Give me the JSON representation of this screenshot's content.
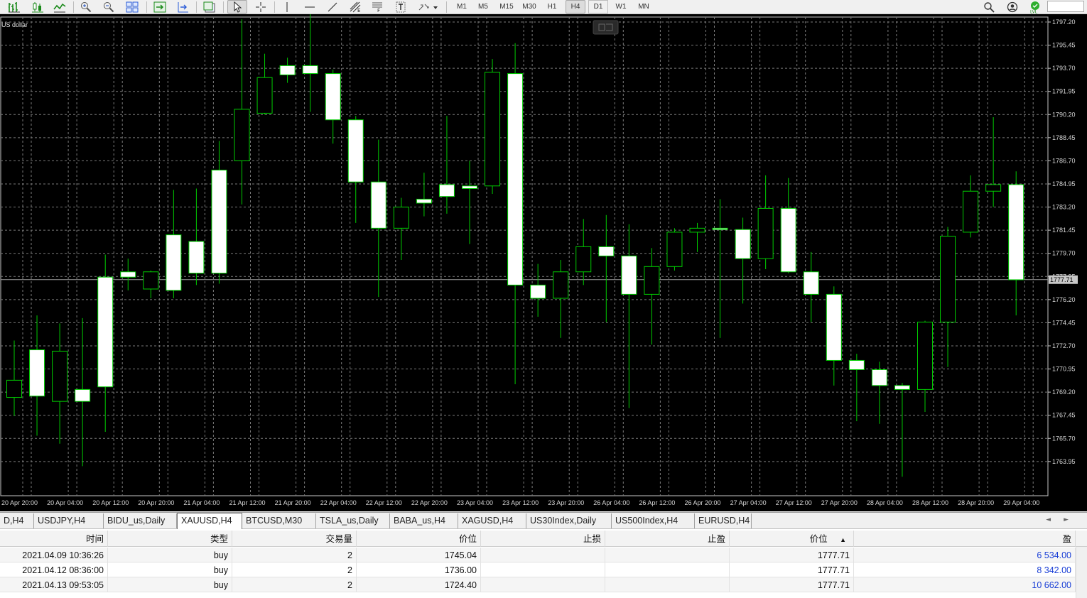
{
  "toolbar": {
    "timeframes": [
      "M1",
      "M5",
      "M15",
      "M30",
      "H1",
      "H4",
      "D1",
      "W1",
      "MN"
    ],
    "active_timeframe": "H4"
  },
  "chart": {
    "symbol_label": "US dollar",
    "price_labels": [
      "1797.20",
      "1795.45",
      "1793.70",
      "1791.95",
      "1790.20",
      "1788.45",
      "1786.70",
      "1784.95",
      "1783.20",
      "1781.45",
      "1779.70",
      "1777.95",
      "1776.20",
      "1774.45",
      "1772.70",
      "1770.95",
      "1769.20",
      "1767.45",
      "1765.70",
      "1763.95"
    ],
    "current_price": "1777.71",
    "time_labels": [
      "20 Apr 20:00",
      "20 Apr 04:00",
      "20 Apr 12:00",
      "20 Apr 20:00",
      "21 Apr 04:00",
      "21 Apr 12:00",
      "21 Apr 20:00",
      "22 Apr 04:00",
      "22 Apr 12:00",
      "22 Apr 20:00",
      "23 Apr 04:00",
      "23 Apr 12:00",
      "23 Apr 20:00",
      "26 Apr 04:00",
      "26 Apr 12:00",
      "26 Apr 20:00",
      "27 Apr 04:00",
      "27 Apr 12:00",
      "27 Apr 20:00",
      "28 Apr 04:00",
      "28 Apr 12:00",
      "28 Apr 20:00",
      "29 Apr 04:00"
    ],
    "colors": {
      "background": "#000000",
      "grid": "#7a7a7a",
      "candle_body": "#ffffff",
      "candle_wick": "#00cc00",
      "bid_line": "#9a9a9a"
    }
  },
  "chart_data": {
    "type": "candlestick",
    "title": "US dollar",
    "ylim": [
      1762.4,
      1798.3
    ],
    "candles": [
      {
        "o": 1768.8,
        "h": 1773.1,
        "l": 1767.4,
        "c": 1770.1
      },
      {
        "o": 1772.4,
        "h": 1775.0,
        "l": 1765.9,
        "c": 1768.9
      },
      {
        "o": 1768.5,
        "h": 1774.4,
        "l": 1765.3,
        "c": 1772.3
      },
      {
        "o": 1769.4,
        "h": 1774.8,
        "l": 1763.6,
        "c": 1768.5
      },
      {
        "o": 1777.9,
        "h": 1779.6,
        "l": 1766.2,
        "c": 1769.6
      },
      {
        "o": 1778.3,
        "h": 1779.3,
        "l": 1776.9,
        "c": 1777.9
      },
      {
        "o": 1777.0,
        "h": 1778.4,
        "l": 1776.3,
        "c": 1778.3
      },
      {
        "o": 1781.1,
        "h": 1784.5,
        "l": 1776.3,
        "c": 1776.9
      },
      {
        "o": 1780.6,
        "h": 1784.6,
        "l": 1777.3,
        "c": 1778.2
      },
      {
        "o": 1786.0,
        "h": 1788.2,
        "l": 1777.4,
        "c": 1778.2
      },
      {
        "o": 1786.7,
        "h": 1797.4,
        "l": 1783.4,
        "c": 1790.6
      },
      {
        "o": 1790.3,
        "h": 1794.8,
        "l": 1790.2,
        "c": 1793.0
      },
      {
        "o": 1793.9,
        "h": 1794.5,
        "l": 1792.6,
        "c": 1793.2
      },
      {
        "o": 1793.9,
        "h": 1797.8,
        "l": 1790.4,
        "c": 1793.3
      },
      {
        "o": 1793.3,
        "h": 1793.6,
        "l": 1788.0,
        "c": 1789.8
      },
      {
        "o": 1789.8,
        "h": 1790.1,
        "l": 1782.0,
        "c": 1785.1
      },
      {
        "o": 1785.1,
        "h": 1788.3,
        "l": 1776.4,
        "c": 1781.6
      },
      {
        "o": 1781.6,
        "h": 1783.9,
        "l": 1779.2,
        "c": 1783.2
      },
      {
        "o": 1783.8,
        "h": 1785.8,
        "l": 1782.5,
        "c": 1783.5
      },
      {
        "o": 1784.9,
        "h": 1790.1,
        "l": 1782.7,
        "c": 1784.0
      },
      {
        "o": 1784.8,
        "h": 1786.7,
        "l": 1780.4,
        "c": 1784.6
      },
      {
        "o": 1784.8,
        "h": 1794.4,
        "l": 1784.2,
        "c": 1793.4
      },
      {
        "o": 1793.3,
        "h": 1795.6,
        "l": 1769.8,
        "c": 1777.3
      },
      {
        "o": 1777.3,
        "h": 1778.9,
        "l": 1774.9,
        "c": 1776.3
      },
      {
        "o": 1776.3,
        "h": 1779.2,
        "l": 1773.3,
        "c": 1778.3
      },
      {
        "o": 1778.3,
        "h": 1782.3,
        "l": 1777.3,
        "c": 1780.2
      },
      {
        "o": 1780.2,
        "h": 1782.6,
        "l": 1774.5,
        "c": 1779.5
      },
      {
        "o": 1779.5,
        "h": 1781.9,
        "l": 1768.0,
        "c": 1776.6
      },
      {
        "o": 1776.6,
        "h": 1780.1,
        "l": 1772.8,
        "c": 1778.7
      },
      {
        "o": 1778.7,
        "h": 1781.6,
        "l": 1778.4,
        "c": 1781.3
      },
      {
        "o": 1781.3,
        "h": 1782.0,
        "l": 1779.8,
        "c": 1781.6
      },
      {
        "o": 1781.6,
        "h": 1783.8,
        "l": 1773.3,
        "c": 1781.5
      },
      {
        "o": 1781.5,
        "h": 1782.4,
        "l": 1775.9,
        "c": 1779.3
      },
      {
        "o": 1779.3,
        "h": 1785.6,
        "l": 1778.5,
        "c": 1783.1
      },
      {
        "o": 1783.1,
        "h": 1785.4,
        "l": 1778.2,
        "c": 1778.3
      },
      {
        "o": 1778.3,
        "h": 1779.8,
        "l": 1774.5,
        "c": 1776.6
      },
      {
        "o": 1776.6,
        "h": 1777.2,
        "l": 1769.7,
        "c": 1771.6
      },
      {
        "o": 1771.6,
        "h": 1772.1,
        "l": 1767.0,
        "c": 1770.9
      },
      {
        "o": 1770.9,
        "h": 1771.5,
        "l": 1766.8,
        "c": 1769.7
      },
      {
        "o": 1769.7,
        "h": 1769.9,
        "l": 1762.8,
        "c": 1769.4
      },
      {
        "o": 1769.4,
        "h": 1774.6,
        "l": 1767.7,
        "c": 1774.5
      },
      {
        "o": 1774.5,
        "h": 1781.7,
        "l": 1771.1,
        "c": 1781.0
      },
      {
        "o": 1781.3,
        "h": 1785.6,
        "l": 1780.9,
        "c": 1784.4
      },
      {
        "o": 1784.4,
        "h": 1790.0,
        "l": 1783.2,
        "c": 1784.9
      },
      {
        "o": 1784.9,
        "h": 1785.9,
        "l": 1775.0,
        "c": 1777.7
      }
    ]
  },
  "symbol_tabs": [
    "D,H4",
    "USDJPY,H4",
    "BIDU_us,Daily",
    "XAUUSD,H4",
    "BTCUSD,M30",
    "TSLA_us,Daily",
    "BABA_us,H4",
    "XAGUSD,H4",
    "US30Index,Daily",
    "US500Index,H4",
    "EURUSD,H4"
  ],
  "active_tab_index": 3,
  "trade_table": {
    "columns": [
      "时间",
      "类型",
      "交易量",
      "价位",
      "止损",
      "止盈",
      "价位",
      "盈"
    ],
    "sort_indicator": "▲",
    "rows": [
      {
        "time": "2021.04.09 10:36:26",
        "type": "buy",
        "volume": "2",
        "open_price": "1745.04",
        "sl": "",
        "tp": "",
        "price": "1777.71",
        "profit": "6 534.00"
      },
      {
        "time": "2021.04.12 08:36:00",
        "type": "buy",
        "volume": "2",
        "open_price": "1736.00",
        "sl": "",
        "tp": "",
        "price": "1777.71",
        "profit": "8 342.00"
      },
      {
        "time": "2021.04.13 09:53:05",
        "type": "buy",
        "volume": "2",
        "open_price": "1724.40",
        "sl": "",
        "tp": "",
        "price": "1777.71",
        "profit": "10 662.00"
      }
    ]
  }
}
